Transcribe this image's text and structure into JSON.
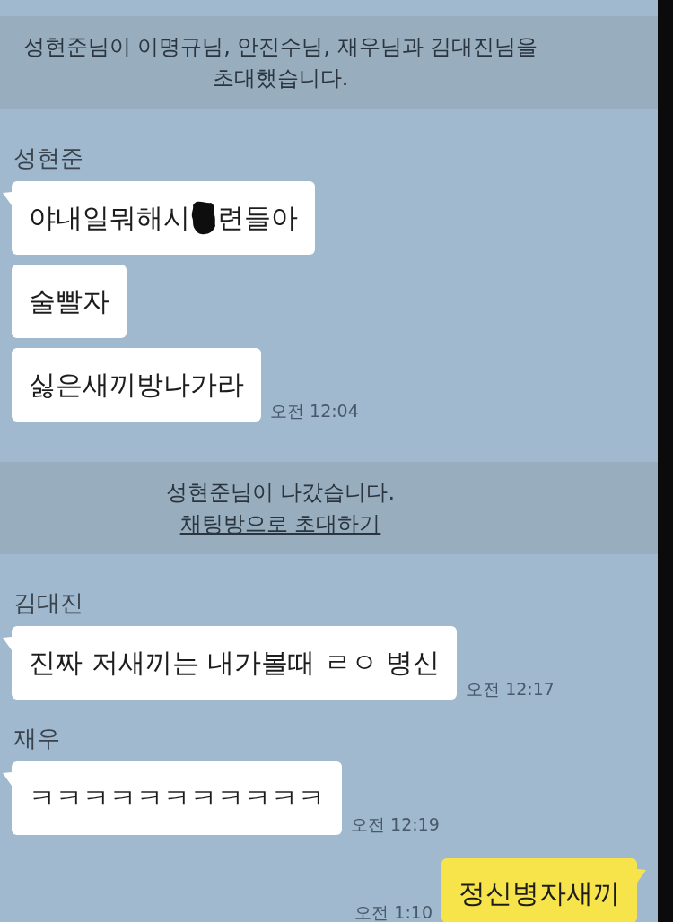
{
  "chat": {
    "items": [
      {
        "kind": "notice",
        "text": "성현준님이 이명규님, 안진수님, 재우님과 김대진님을\n초대했습니다."
      },
      {
        "kind": "group",
        "sender": "성현준",
        "messages": [
          {
            "kind": "redacted",
            "parts": [
              "야내일뭐해시",
              "련들아"
            ]
          },
          {
            "kind": "text",
            "text": "술빨자"
          },
          {
            "kind": "text",
            "text": "싫은새끼방나가라",
            "time": "오전 12:04"
          }
        ]
      },
      {
        "kind": "notice",
        "text": "성현준님이 나갔습니다.",
        "link": "채팅방으로 초대하기"
      },
      {
        "kind": "group",
        "sender": "김대진",
        "messages": [
          {
            "kind": "text",
            "text": "진짜 저새끼는 내가볼때 ㄹㅇ 병신",
            "time": "오전 12:17"
          }
        ]
      },
      {
        "kind": "group",
        "sender": "재우",
        "messages": [
          {
            "kind": "text",
            "text": "ㅋㅋㅋㅋㅋㅋㅋㅋㅋㅋㅋ",
            "time": "오전 12:19"
          }
        ]
      },
      {
        "kind": "mine",
        "messages": [
          {
            "kind": "text",
            "text": "정신병자새끼",
            "time": "오전 1:10"
          }
        ]
      }
    ]
  }
}
